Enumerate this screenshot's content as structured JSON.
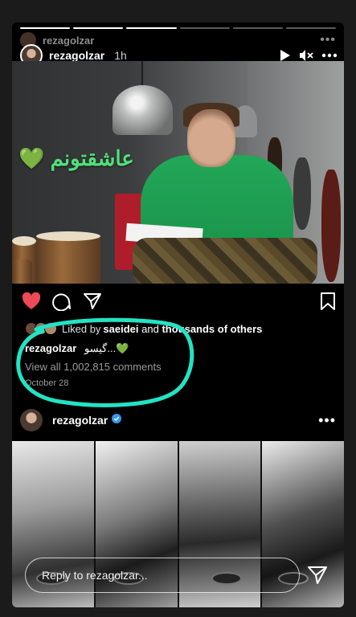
{
  "story": {
    "progress_segments": 6,
    "progress_done": 3,
    "username": "rezagolzar",
    "time": "1h"
  },
  "under_post": {
    "username": "rezagolzar"
  },
  "photo": {
    "overlay_text": "عاشقتونم 💚"
  },
  "post": {
    "liked_prefix": "Liked by ",
    "liked_user": "saeidei",
    "liked_mid": " and ",
    "liked_suffix": "thousands of others",
    "caption_user": "rezagolzar",
    "caption_text": "گیسو...💚",
    "view_comments": "View all 1,002,815 comments",
    "date": "October 28"
  },
  "post2": {
    "username": "rezagolzar"
  },
  "reply": {
    "placeholder": "Reply to rezagolzar..."
  },
  "colors": {
    "heart": "#ed4956",
    "annotation": "#22e3c4",
    "verified": "#3897f0",
    "overlay_text": "#52e07a"
  }
}
